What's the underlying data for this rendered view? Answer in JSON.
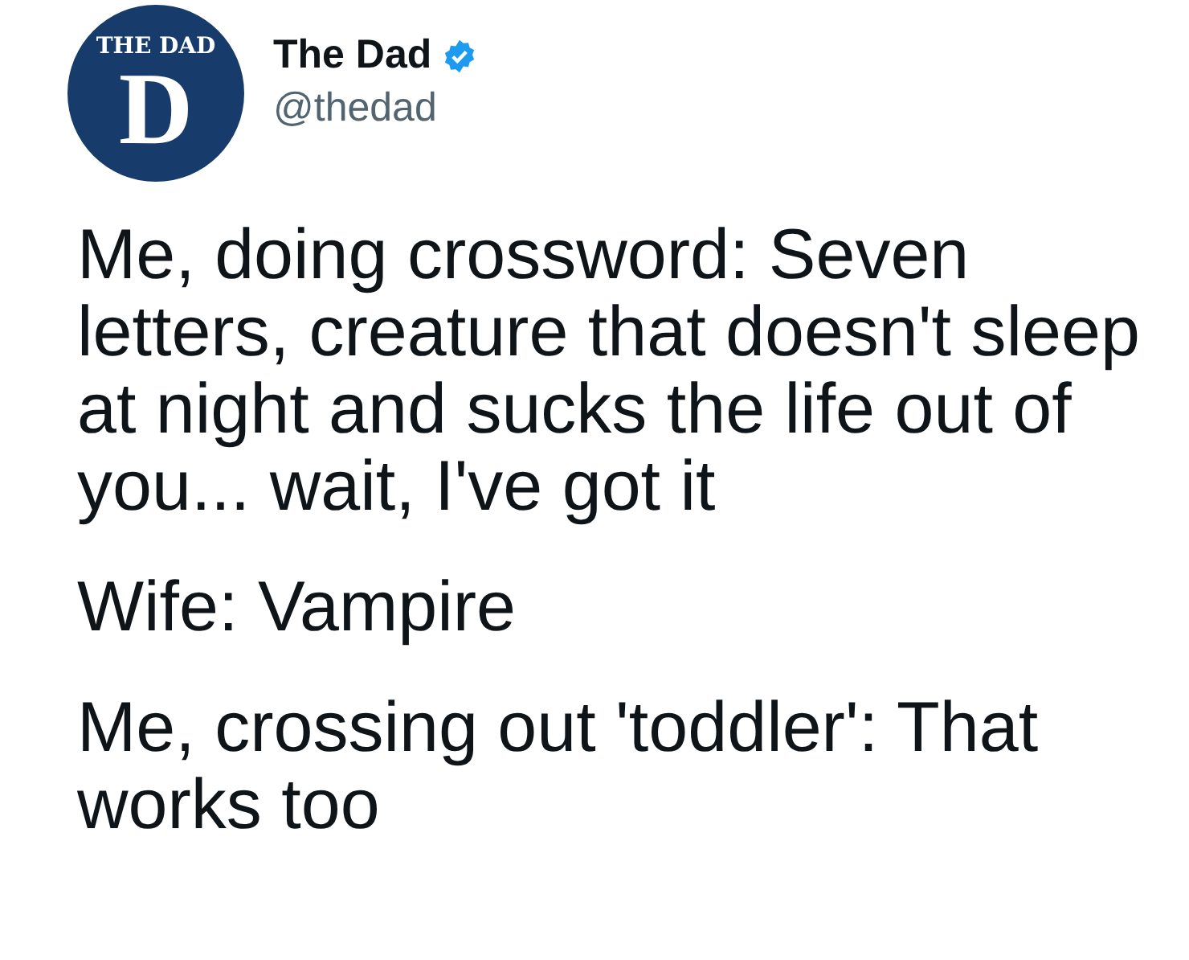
{
  "author": {
    "avatar": {
      "letter": "D",
      "text": "THE DAD"
    },
    "name": "The Dad",
    "verified": true,
    "handle": "@thedad"
  },
  "paragraphs": [
    "Me, doing crossword: Seven letters, creature that doesn't sleep at night and sucks the life out of you... wait, I've got it",
    "Wife: Vampire",
    "Me, crossing out 'toddler': That works too"
  ]
}
